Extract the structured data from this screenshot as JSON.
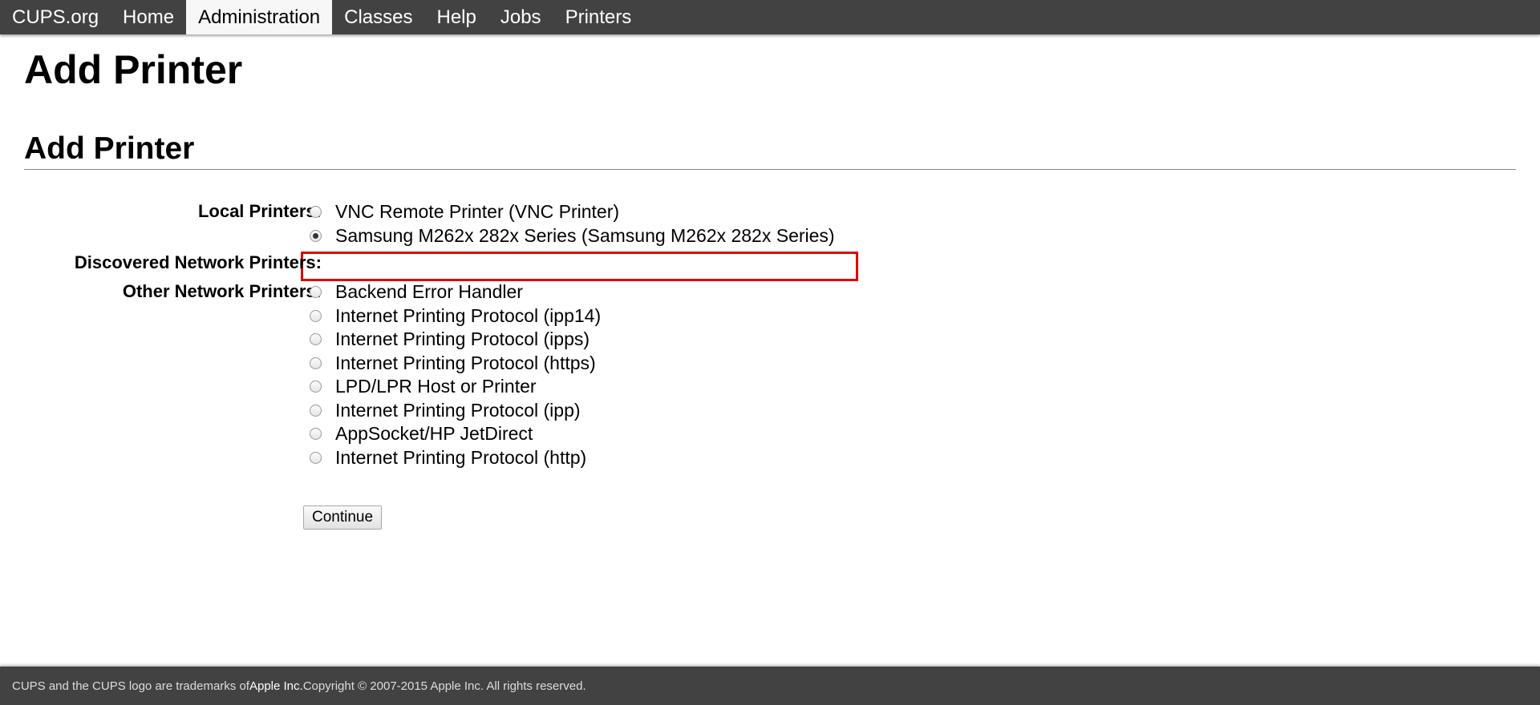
{
  "nav": {
    "items": [
      {
        "label": "CUPS.org",
        "active": false
      },
      {
        "label": "Home",
        "active": false
      },
      {
        "label": "Administration",
        "active": true
      },
      {
        "label": "Classes",
        "active": false
      },
      {
        "label": "Help",
        "active": false
      },
      {
        "label": "Jobs",
        "active": false
      },
      {
        "label": "Printers",
        "active": false
      }
    ]
  },
  "page": {
    "title": "Add Printer",
    "section_title": "Add Printer"
  },
  "form": {
    "local_label": "Local Printers:",
    "local_options": [
      {
        "label": "VNC Remote Printer (VNC Printer)",
        "checked": false
      },
      {
        "label": "Samsung M262x 282x Series (Samsung M262x 282x Series)",
        "checked": true
      }
    ],
    "discovered_label": "Discovered Network Printers:",
    "other_label": "Other Network Printers:",
    "other_options": [
      {
        "label": "Backend Error Handler",
        "checked": false
      },
      {
        "label": "Internet Printing Protocol (ipp14)",
        "checked": false
      },
      {
        "label": "Internet Printing Protocol (ipps)",
        "checked": false
      },
      {
        "label": "Internet Printing Protocol (https)",
        "checked": false
      },
      {
        "label": "LPD/LPR Host or Printer",
        "checked": false
      },
      {
        "label": "Internet Printing Protocol (ipp)",
        "checked": false
      },
      {
        "label": "AppSocket/HP JetDirect",
        "checked": false
      },
      {
        "label": "Internet Printing Protocol (http)",
        "checked": false
      }
    ],
    "continue_label": "Continue"
  },
  "footer": {
    "text_prefix": "CUPS and the CUPS logo are trademarks of ",
    "company": "Apple Inc.",
    "text_suffix": " Copyright © 2007-2015 Apple Inc. All rights reserved."
  },
  "colors": {
    "header_bg": "#424242",
    "highlight": "#e00000"
  }
}
